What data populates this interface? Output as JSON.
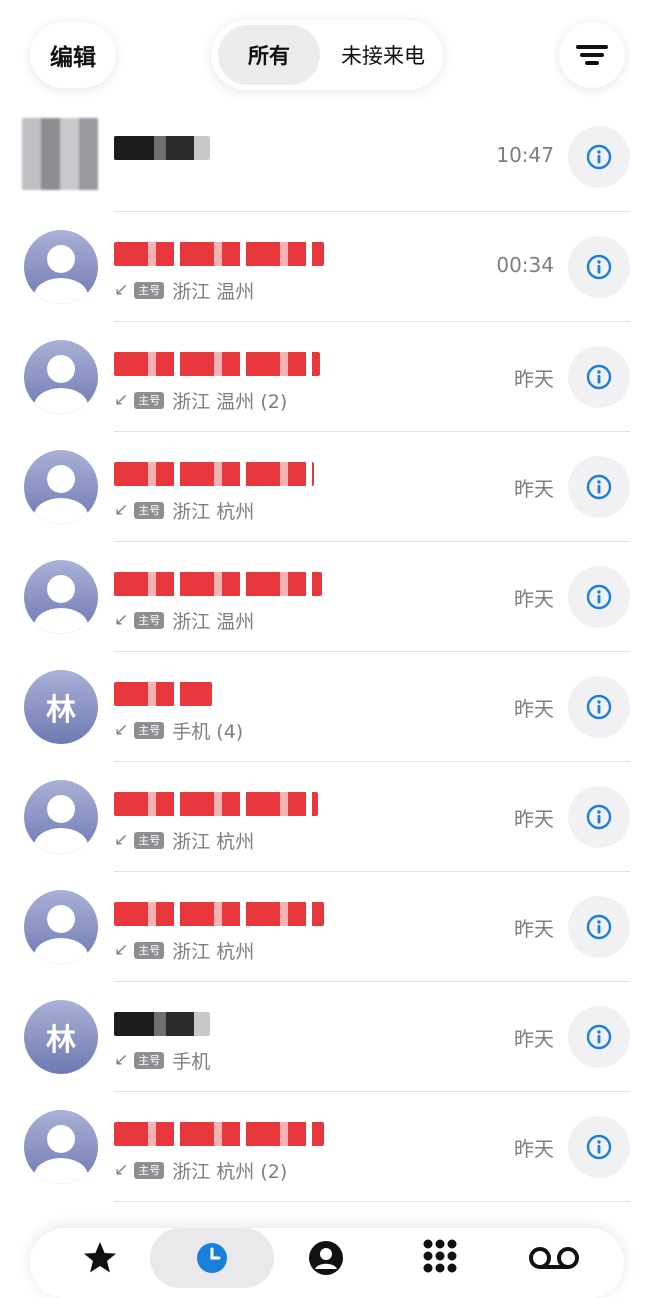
{
  "header": {
    "edit_label": "编辑",
    "filter_all": "所有",
    "filter_missed": "未接来电"
  },
  "colors": {
    "accent": "#1a7fd9",
    "secondary_text": "#7d7d83",
    "avatar_gradient_top": "#a9b1d6",
    "avatar_gradient_bottom": "#6f79b3"
  },
  "calls": [
    {
      "avatar": "photo",
      "location": "",
      "time": "10:47"
    },
    {
      "avatar": "person",
      "tag": "主号",
      "location": "浙江 温州",
      "time": "00:34"
    },
    {
      "avatar": "person",
      "tag": "主号",
      "location": "浙江 温州 (2)",
      "time": "昨天"
    },
    {
      "avatar": "person",
      "tag": "主号",
      "location": "浙江 杭州",
      "time": "昨天"
    },
    {
      "avatar": "person",
      "tag": "主号",
      "location": "浙江 温州",
      "time": "昨天"
    },
    {
      "avatar": "林",
      "tag": "主号",
      "location": "手机 (4)",
      "time": "昨天"
    },
    {
      "avatar": "person",
      "tag": "主号",
      "location": "浙江 杭州",
      "time": "昨天"
    },
    {
      "avatar": "person",
      "tag": "主号",
      "location": "浙江 杭州",
      "time": "昨天"
    },
    {
      "avatar": "林",
      "tag": "主号",
      "location": "手机",
      "time": "昨天"
    },
    {
      "avatar": "person",
      "tag": "主号",
      "location": "浙江 杭州 (2)",
      "time": "昨天"
    }
  ],
  "tabbar": {
    "items": [
      "favorites-icon",
      "recents-icon",
      "contacts-icon",
      "keypad-icon",
      "voicemail-icon"
    ],
    "active": "recents-icon"
  }
}
